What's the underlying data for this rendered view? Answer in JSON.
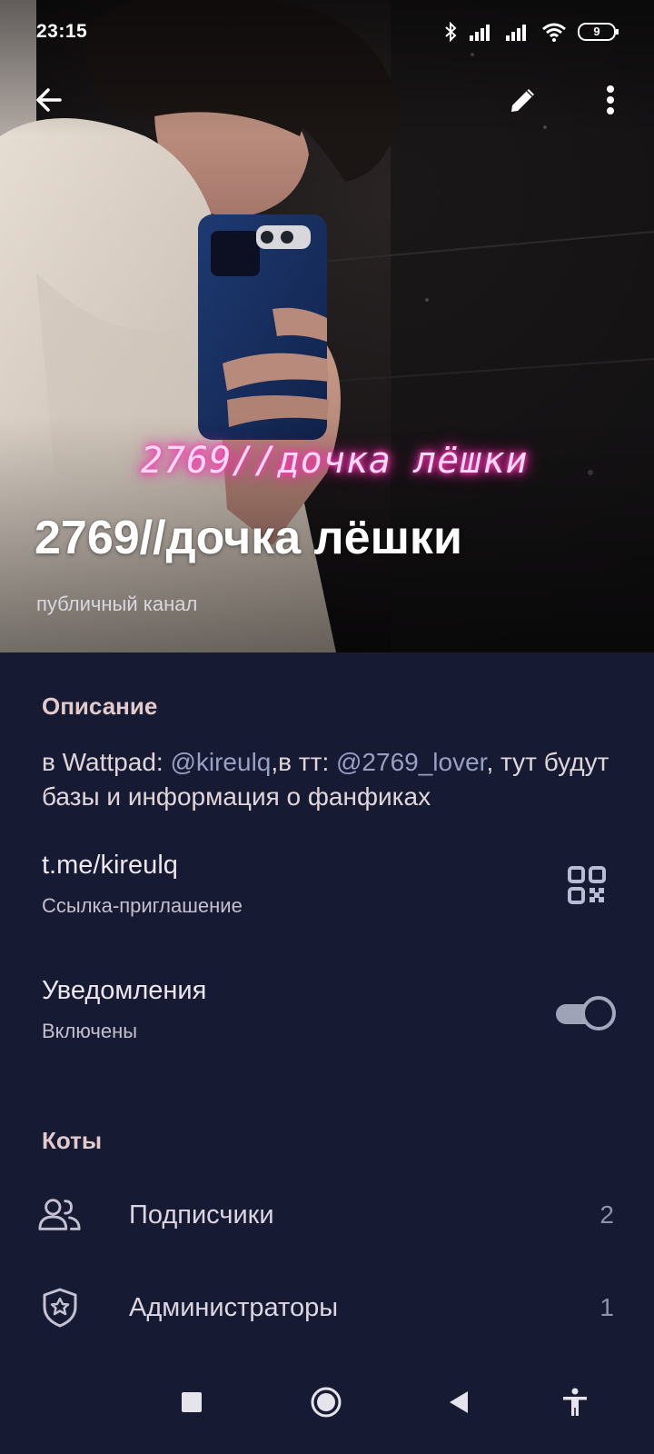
{
  "status_bar": {
    "time": "23:15",
    "battery": "9",
    "icons": [
      "bluetooth-icon",
      "signal-icon",
      "signal-icon",
      "wifi-icon",
      "battery-icon"
    ]
  },
  "toolbar": {
    "back_icon": "arrow-left-icon",
    "edit_icon": "pencil-icon",
    "more_icon": "more-vertical-icon"
  },
  "header": {
    "image_caption": "2769//дочка лёшки",
    "title": "2769//дочка лёшки",
    "subtitle": "публичный канал"
  },
  "info": {
    "description_heading": "Описание",
    "description": {
      "part1": "в Wattpad: ",
      "mention1": "@kireulq",
      "part2": ",в тт: ",
      "mention2": "@2769_lover",
      "part3": ", тут будут базы и информация о фанфиках"
    },
    "link": "t.me/kireulq",
    "link_caption": "Ссылка-приглашение",
    "notifications_label": "Уведомления",
    "notifications_status": "Включены",
    "notifications_on": true
  },
  "members": {
    "heading": "Коты",
    "rows": [
      {
        "label": "Подписчики",
        "count": "2",
        "icon": "people-icon"
      },
      {
        "label": "Администраторы",
        "count": "1",
        "icon": "admin-shield-icon"
      }
    ]
  },
  "colors": {
    "panel_bg": "#161a33",
    "section_heading": "#e3c9c9",
    "mention": "#9a9fc4",
    "watermark_glow": "#ff2aa8"
  },
  "navbar": {
    "icons": [
      "recents-square-icon",
      "home-circle-icon",
      "back-triangle-icon",
      "accessibility-icon"
    ]
  }
}
